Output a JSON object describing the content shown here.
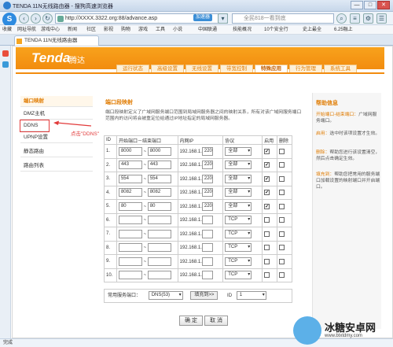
{
  "window": {
    "title": "TENDA 11N无线路由器 - 搜狗高速浏览器",
    "min": "—",
    "max": "□",
    "close": "✕"
  },
  "address": {
    "url": "http://XXXX.3322.org:88/advance.asp",
    "speed_badge": "加速器",
    "search_placeholder": "全民818一看到底"
  },
  "favorites": [
    "收藏",
    "网址导航",
    "游戏中心",
    "新闻",
    "社区",
    "影视",
    "购物",
    "游戏",
    "工具",
    "小说",
    "中国联通",
    "技能概况",
    "10个安全行",
    "史上最全",
    "6.25融上"
  ],
  "tab": {
    "label": "TENDA 11N无线路由器"
  },
  "router": {
    "brand": "Tenda",
    "brand_cn": "腾达",
    "nav": [
      "运行状态",
      "高级设置",
      "无线设置",
      "带宽控制",
      "特殊应用",
      "行为管理",
      "系统工具"
    ],
    "nav_active": 4,
    "menu": [
      "端口映射",
      "DMZ主机",
      "DDNS",
      "UPNP设置",
      "静态路由",
      "路由列表"
    ],
    "menu_active": 0,
    "menu_highlight": 2,
    "annotation": "点击\"DDNS\"",
    "section_title": "端口段映射",
    "description": "端口段映射定义了广域网服务端口范围到局域网服务器之间的映射关系，所有对该广域网服务端口范围内的访问将会被重定位给通过IP地址指定的局域网服务器。",
    "table": {
      "headers": [
        "ID",
        "开始端口－结束端口",
        "内网IP",
        "协议",
        "启用",
        "删除"
      ],
      "ip_prefix": "192.168.1.",
      "rows": [
        {
          "id": "1.",
          "start": "8000",
          "end": "8000",
          "ip": "220",
          "proto": "全部",
          "enabled": "✔"
        },
        {
          "id": "2.",
          "start": "443",
          "end": "443",
          "ip": "220",
          "proto": "全部",
          "enabled": "✔"
        },
        {
          "id": "3.",
          "start": "554",
          "end": "554",
          "ip": "220",
          "proto": "全部",
          "enabled": "✔"
        },
        {
          "id": "4.",
          "start": "8082",
          "end": "8082",
          "ip": "220",
          "proto": "全部",
          "enabled": "✔"
        },
        {
          "id": "5.",
          "start": "80",
          "end": "80",
          "ip": "220",
          "proto": "全部",
          "enabled": "✔"
        },
        {
          "id": "6.",
          "start": "",
          "end": "",
          "ip": "",
          "proto": "TCP",
          "enabled": ""
        },
        {
          "id": "7.",
          "start": "",
          "end": "",
          "ip": "",
          "proto": "TCP",
          "enabled": ""
        },
        {
          "id": "8.",
          "start": "",
          "end": "",
          "ip": "",
          "proto": "TCP",
          "enabled": ""
        },
        {
          "id": "9.",
          "start": "",
          "end": "",
          "ip": "",
          "proto": "TCP",
          "enabled": ""
        },
        {
          "id": "10.",
          "start": "",
          "end": "",
          "ip": "",
          "proto": "TCP",
          "enabled": ""
        }
      ]
    },
    "service": {
      "label": "常用服务端口：",
      "value": "DNS(53)",
      "fill_btn": "填充到>>",
      "id_label": "ID",
      "id_value": "1"
    },
    "ok": "确 定",
    "cancel": "取 消",
    "help": {
      "title": "帮助信息",
      "p1_key": "开始端口-结束端口：",
      "p1": "广域网服务端口。",
      "p2_key": "启用：",
      "p2": "选中时该项设置才生效。",
      "p3_key": "删除：",
      "p3": "帮助您进行该设置清空，然后点击确定生效。",
      "p4_key": "填充到：",
      "p4": "帮助您把常用的服务端口加载设置的映射端口并开启端口。"
    }
  },
  "status": "完成",
  "watermark": {
    "title": "冰糖安卓网",
    "url": "www.btxtdmy.com"
  }
}
